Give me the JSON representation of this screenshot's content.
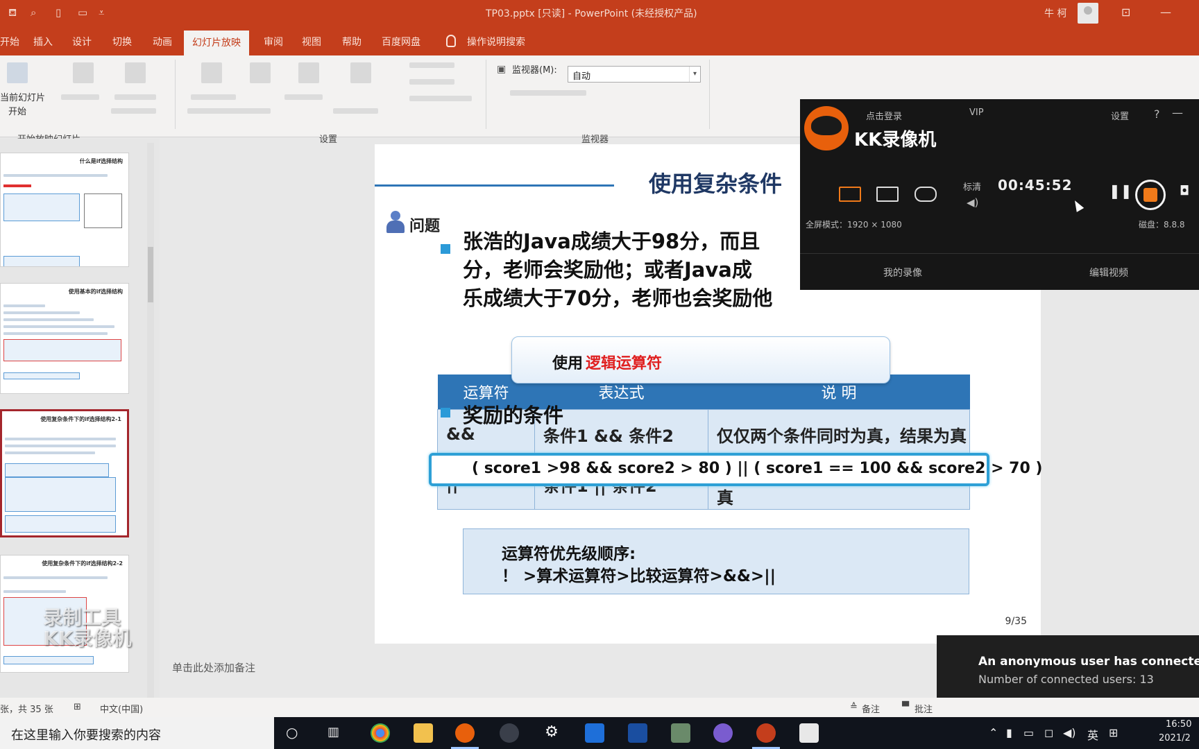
{
  "titlebar": {
    "title": "TP03.pptx [只读] - PowerPoint (未经授权产品)",
    "user": "牛 柯",
    "qa_more": "⩡"
  },
  "tabs": [
    "开始",
    "插入",
    "设计",
    "切换",
    "动画",
    "幻灯片放映",
    "审阅",
    "视图",
    "帮助",
    "百度网盘",
    "操作说明搜索"
  ],
  "ribbon": {
    "from_current_line1": "当前幻灯片",
    "from_current_line2": "开始",
    "group_start": "开始放映幻灯片",
    "group_setup": "设置",
    "group_monitor": "监视器",
    "monitor_label": "监视器(M):",
    "monitor_value": "自动"
  },
  "thumbs": [
    {
      "title": "什么是if选择结构"
    },
    {
      "title": "使用基本的if选择结构"
    },
    {
      "title": "使用复杂条件下的if选择结构2-1"
    },
    {
      "title": "使用复杂条件下的if选择结构2-2"
    }
  ],
  "slide": {
    "title": "使用复杂条件",
    "question_label": "问题",
    "para_lines": [
      "张浩的Java成绩大于98分，而且",
      "分，老师会奖励他；或者Java成",
      "乐成绩大于70分，老师也会奖励他"
    ],
    "logic_prefix": "使用",
    "logic_highlight": "逻辑运算符",
    "table_headers": [
      "运算符",
      "表达式",
      "说    明"
    ],
    "rows": [
      {
        "op": "&&",
        "expr": "条件1 && 条件2",
        "desc": "仅仅两个条件同时为真，结果为真"
      },
      {
        "op": "||",
        "expr": "条件1 || 条件2",
        "desc": "只要两个条件有一个为真，结果为真"
      }
    ],
    "award_label": "奖励的条件",
    "expression": "( score1 >98 && score2 > 80 ) || ( score1 == 100 && score2 > 70 )",
    "prio_line1": "运算符优先级顺序:",
    "prio_line2": "！ >算术运算符>比较运算符>&&>||",
    "page_number": "9/35"
  },
  "notes_placeholder": "单击此处添加备注",
  "kk": {
    "login": "点击登录",
    "vip": "VIP",
    "settings": "设置",
    "help": "?",
    "minimize": "—",
    "brand": "KK录像机",
    "quality": "标清",
    "time": "00:45:52",
    "fullscreen_label": "全屏模式：1920 × 1080",
    "speed_label": "磁盘：8.8.8",
    "my_recordings": "我的录像",
    "edit_video": "编辑视频",
    "watermark_line1": "录制工具",
    "watermark_line2": "KK录像机"
  },
  "notification": {
    "line1": "An anonymous user has connected",
    "line2": "Number of connected users: 13"
  },
  "statusbar": {
    "slide_count": "张，共 35 张",
    "language": "中文(中国)",
    "notes": "备注",
    "comments": "批注"
  },
  "taskbar": {
    "search_placeholder": "在这里输入你要搜索的内容",
    "ime": "英",
    "time": "16:50",
    "date": "2021/2"
  }
}
